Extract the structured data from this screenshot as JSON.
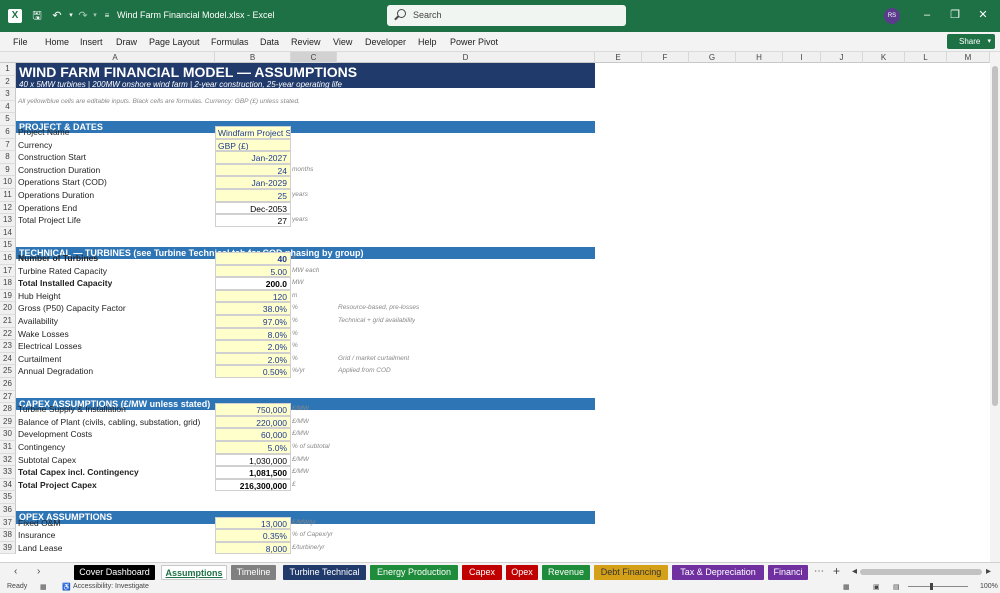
{
  "window": {
    "title": "Wind Farm Financial Model.xlsx  -  Excel",
    "search_placeholder": "Search",
    "user_initials": "RS"
  },
  "menu": [
    "File",
    "Home",
    "Insert",
    "Draw",
    "Page Layout",
    "Formulas",
    "Data",
    "Review",
    "View",
    "Developer",
    "Help",
    "Power Pivot"
  ],
  "share_label": "Share",
  "columns": [
    "A",
    "B",
    "C",
    "D",
    "E",
    "F",
    "G",
    "H",
    "I",
    "J",
    "K",
    "L",
    "M"
  ],
  "sheet": {
    "title": "WIND FARM FINANCIAL MODEL — ASSUMPTIONS",
    "subtitle": "40 x 5MW turbines | 200MW onshore wind farm | 2-year construction, 25-year operating life",
    "note": "All yellow/blue cells are editable inputs. Black cells are formulas. Currency: GBP (£) unless stated.",
    "sections": {
      "project": "PROJECT & DATES",
      "technical": "TECHNICAL — TURBINES  (see Turbine Technical tab for COD phasing by group)",
      "capex": "CAPEX ASSUMPTIONS (£/MW unless stated)",
      "opex": "OPEX ASSUMPTIONS"
    },
    "rows": [
      {
        "label": "Project Name",
        "value": "Windfarm Project SPV Ltd",
        "unit": "",
        "note": ""
      },
      {
        "label": "Currency",
        "value": "GBP (£)",
        "unit": "",
        "note": ""
      },
      {
        "label": "Construction Start",
        "value": "Jan-2027",
        "unit": "",
        "note": ""
      },
      {
        "label": "Construction Duration",
        "value": "24",
        "unit": "months",
        "note": ""
      },
      {
        "label": "Operations Start (COD)",
        "value": "Jan-2029",
        "unit": "",
        "note": ""
      },
      {
        "label": "Operations Duration",
        "value": "25",
        "unit": "years",
        "note": ""
      },
      {
        "label": "Operations End",
        "value": "Dec-2053",
        "unit": "",
        "note": ""
      },
      {
        "label": "Total Project Life",
        "value": "27",
        "unit": "years",
        "note": ""
      },
      {
        "label": "Number of Turbines",
        "value": "40",
        "unit": "#",
        "note": ""
      },
      {
        "label": "Turbine Rated Capacity",
        "value": "5.00",
        "unit": "MW each",
        "note": ""
      },
      {
        "label": "Total Installed Capacity",
        "value": "200.0",
        "unit": "MW",
        "note": ""
      },
      {
        "label": "Hub Height",
        "value": "120",
        "unit": "m",
        "note": ""
      },
      {
        "label": "Gross (P50) Capacity Factor",
        "value": "38.0%",
        "unit": "%",
        "note": "Resource-based, pre-losses"
      },
      {
        "label": "Availability",
        "value": "97.0%",
        "unit": "%",
        "note": "Technical + grid availability"
      },
      {
        "label": "Wake Losses",
        "value": "8.0%",
        "unit": "%",
        "note": ""
      },
      {
        "label": "Electrical Losses",
        "value": "2.0%",
        "unit": "%",
        "note": ""
      },
      {
        "label": "Curtailment",
        "value": "2.0%",
        "unit": "%",
        "note": "Grid / market curtailment"
      },
      {
        "label": "Annual Degradation",
        "value": "0.50%",
        "unit": "%/yr",
        "note": "Applied from COD"
      },
      {
        "label": "Turbine Supply & Installation",
        "value": "750,000",
        "unit": "£/MW",
        "note": ""
      },
      {
        "label": "Balance of Plant (civils, cabling, substation, grid)",
        "value": "220,000",
        "unit": "£/MW",
        "note": ""
      },
      {
        "label": "Development Costs",
        "value": "60,000",
        "unit": "£/MW",
        "note": ""
      },
      {
        "label": "Contingency",
        "value": "5.0%",
        "unit": "% of subtotal",
        "note": ""
      },
      {
        "label": "Subtotal Capex",
        "value": "1,030,000",
        "unit": "£/MW",
        "note": ""
      },
      {
        "label": "Total Capex incl. Contingency",
        "value": "1,081,500",
        "unit": "£/MW",
        "note": ""
      },
      {
        "label": "Total Project Capex",
        "value": "216,300,000",
        "unit": "£",
        "note": ""
      },
      {
        "label": "Fixed O&M",
        "value": "13,000",
        "unit": "£/MW/yr",
        "note": ""
      },
      {
        "label": "Insurance",
        "value": "0.35%",
        "unit": "% of Capex/yr",
        "note": ""
      },
      {
        "label": "Land Lease",
        "value": "8,000",
        "unit": "£/turbine/yr",
        "note": ""
      }
    ]
  },
  "tabs": [
    {
      "label": "Cover Dashboard",
      "color": "#000000"
    },
    {
      "label": "Assumptions",
      "color": "#ffffff"
    },
    {
      "label": "Timeline",
      "color": "#808080"
    },
    {
      "label": "Turbine Technical",
      "color": "#1f3a6b"
    },
    {
      "label": "Energy Production",
      "color": "#1e8c3a"
    },
    {
      "label": "Capex",
      "color": "#c00000"
    },
    {
      "label": "Opex",
      "color": "#c00000"
    },
    {
      "label": "Revenue",
      "color": "#1e8c3a"
    },
    {
      "label": "Debt Financing",
      "color": "#d4a017"
    },
    {
      "label": "Tax & Depreciation",
      "color": "#7030a0"
    },
    {
      "label": "Financi",
      "color": "#7030a0"
    }
  ],
  "status": {
    "ready": "Ready",
    "accessibility": "Accessibility: Investigate",
    "zoom": "100%"
  }
}
